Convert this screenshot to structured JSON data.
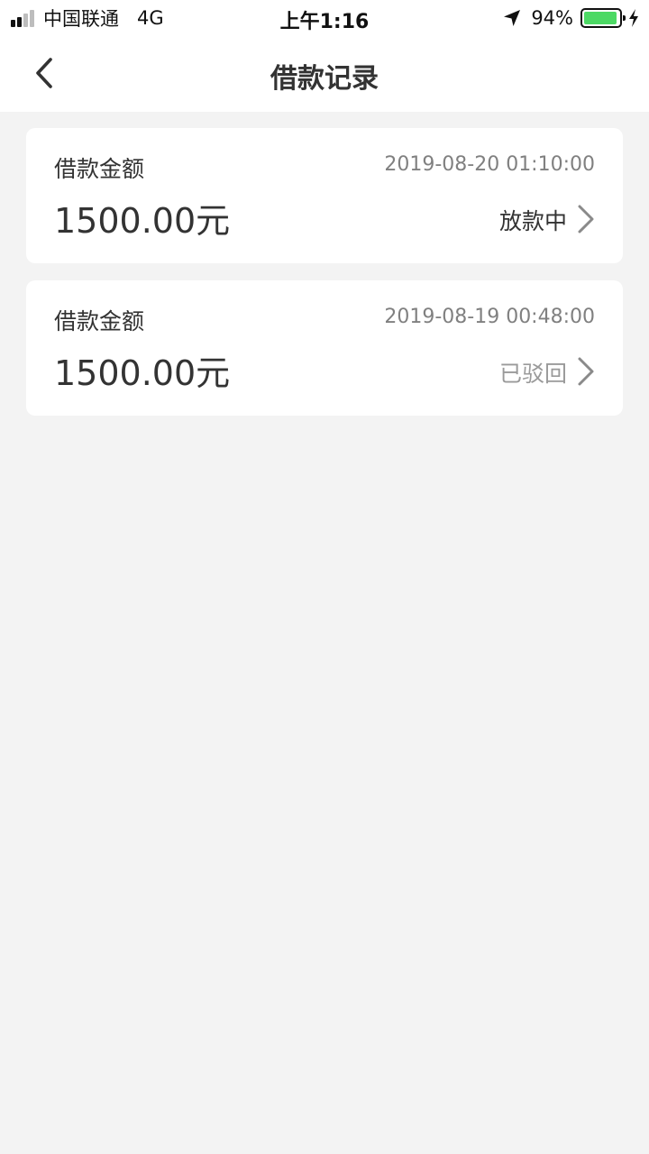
{
  "status_bar": {
    "carrier": "中国联通",
    "network": "4G",
    "time": "上午1:16",
    "battery_percent": "94%",
    "battery_level": 0.94,
    "signal_bars": 4,
    "signal_active": 2,
    "icons": [
      "location-arrow-icon",
      "battery-icon",
      "charging-bolt-icon"
    ]
  },
  "nav": {
    "title": "借款记录",
    "back_icon": "chevron-left-icon"
  },
  "records": [
    {
      "label": "借款金额",
      "time": "2019-08-20 01:10:00",
      "amount": "1500.00元",
      "status": "放款中"
    },
    {
      "label": "借款金额",
      "time": "2019-08-19 00:48:00",
      "amount": "1500.00元",
      "status": "已驳回"
    }
  ],
  "colors": {
    "background": "#f3f3f3",
    "card": "#ffffff",
    "text_primary": "#333333",
    "text_secondary": "#808080",
    "status_muted": "#9a9a9a",
    "battery_fill": "#4cd964"
  }
}
